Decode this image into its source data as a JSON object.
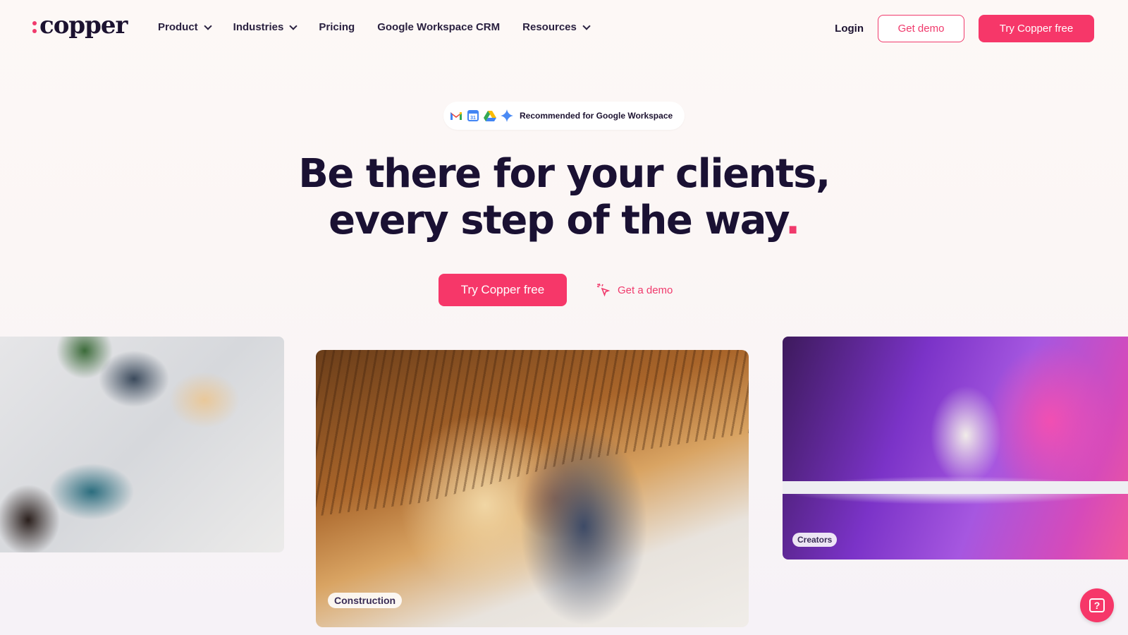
{
  "nav": {
    "logo_text": "copper",
    "links": [
      {
        "label": "Product",
        "dropdown": true
      },
      {
        "label": "Industries",
        "dropdown": true
      },
      {
        "label": "Pricing",
        "dropdown": false
      },
      {
        "label": "Google Workspace CRM",
        "dropdown": false
      },
      {
        "label": "Resources",
        "dropdown": true
      }
    ],
    "login": "Login",
    "get_demo": "Get demo",
    "try_free": "Try Copper free"
  },
  "badge": {
    "icons": [
      "gmail-icon",
      "calendar-icon",
      "drive-icon",
      "gemini-icon"
    ],
    "text": "Recommended for Google Workspace"
  },
  "hero": {
    "line1": "Be there for your clients,",
    "line2": "every step of the way",
    "line2_dot": ".",
    "cta_primary": "Try Copper free",
    "cta_secondary": "Get a demo"
  },
  "photos": {
    "construction_tag": "Construction",
    "creators_tag": "Creators"
  },
  "colors": {
    "accent": "#f63769",
    "text": "#1a1133",
    "background": "#fdf8f6"
  },
  "help": {
    "icon": "help-chat-icon",
    "glyph": "?"
  }
}
